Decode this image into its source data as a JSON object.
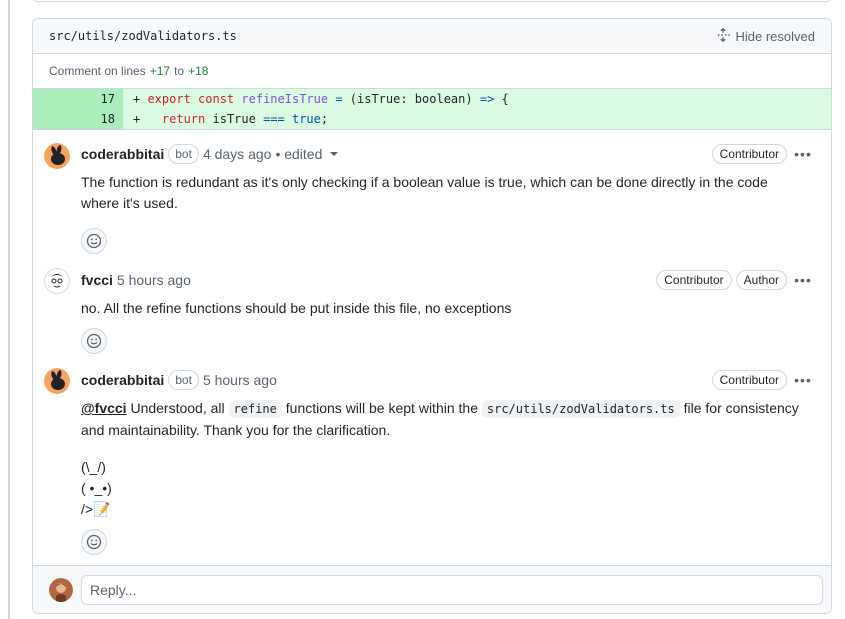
{
  "file": {
    "path": "src/utils/zodValidators.ts",
    "hide_resolved_label": "Hide resolved",
    "comment_on_prefix": "Comment on lines",
    "line_start": "+17",
    "line_sep": "to",
    "line_end": "+18"
  },
  "diff": {
    "lines": [
      {
        "num": "17"
      },
      {
        "num": "18"
      }
    ]
  },
  "comments": [
    {
      "author": "coderabbitai",
      "badge": "bot",
      "time": "4 days ago",
      "edited": "• edited",
      "roles": [
        "Contributor"
      ],
      "body": "The function is redundant as it's only checking if a boolean value is true, which can be done directly in the code where it's used."
    },
    {
      "author": "fvcci",
      "time": "5 hours ago",
      "roles": [
        "Contributor",
        "Author"
      ],
      "body": "no. All the refine functions should be put inside this file, no exceptions"
    },
    {
      "author": "coderabbitai",
      "badge": "bot",
      "time": "5 hours ago",
      "roles": [
        "Contributor"
      ],
      "mention": "@fvcci",
      "body_part1": " Understood, all ",
      "code1": "refine",
      "body_part2": " functions will be kept within the ",
      "code2": "src/utils/zodValidators.ts",
      "body_part3": " file for consistency and maintainability. Thank you for the clarification.",
      "ascii_line1": "(\\_/)",
      "ascii_line2": "( •_•)",
      "ascii_line3": "/>📝"
    }
  ],
  "reply": {
    "placeholder": "Reply..."
  },
  "icons": {
    "kebab": "kebab-horizontal-icon",
    "smiley": "smiley-icon",
    "unfold": "unfold-icon"
  },
  "colors": {
    "diff_added_bg": "#dafbe1",
    "diff_lineno_bg": "#aceebb",
    "added_text": "#1a7f37",
    "border": "#d0d7de"
  }
}
